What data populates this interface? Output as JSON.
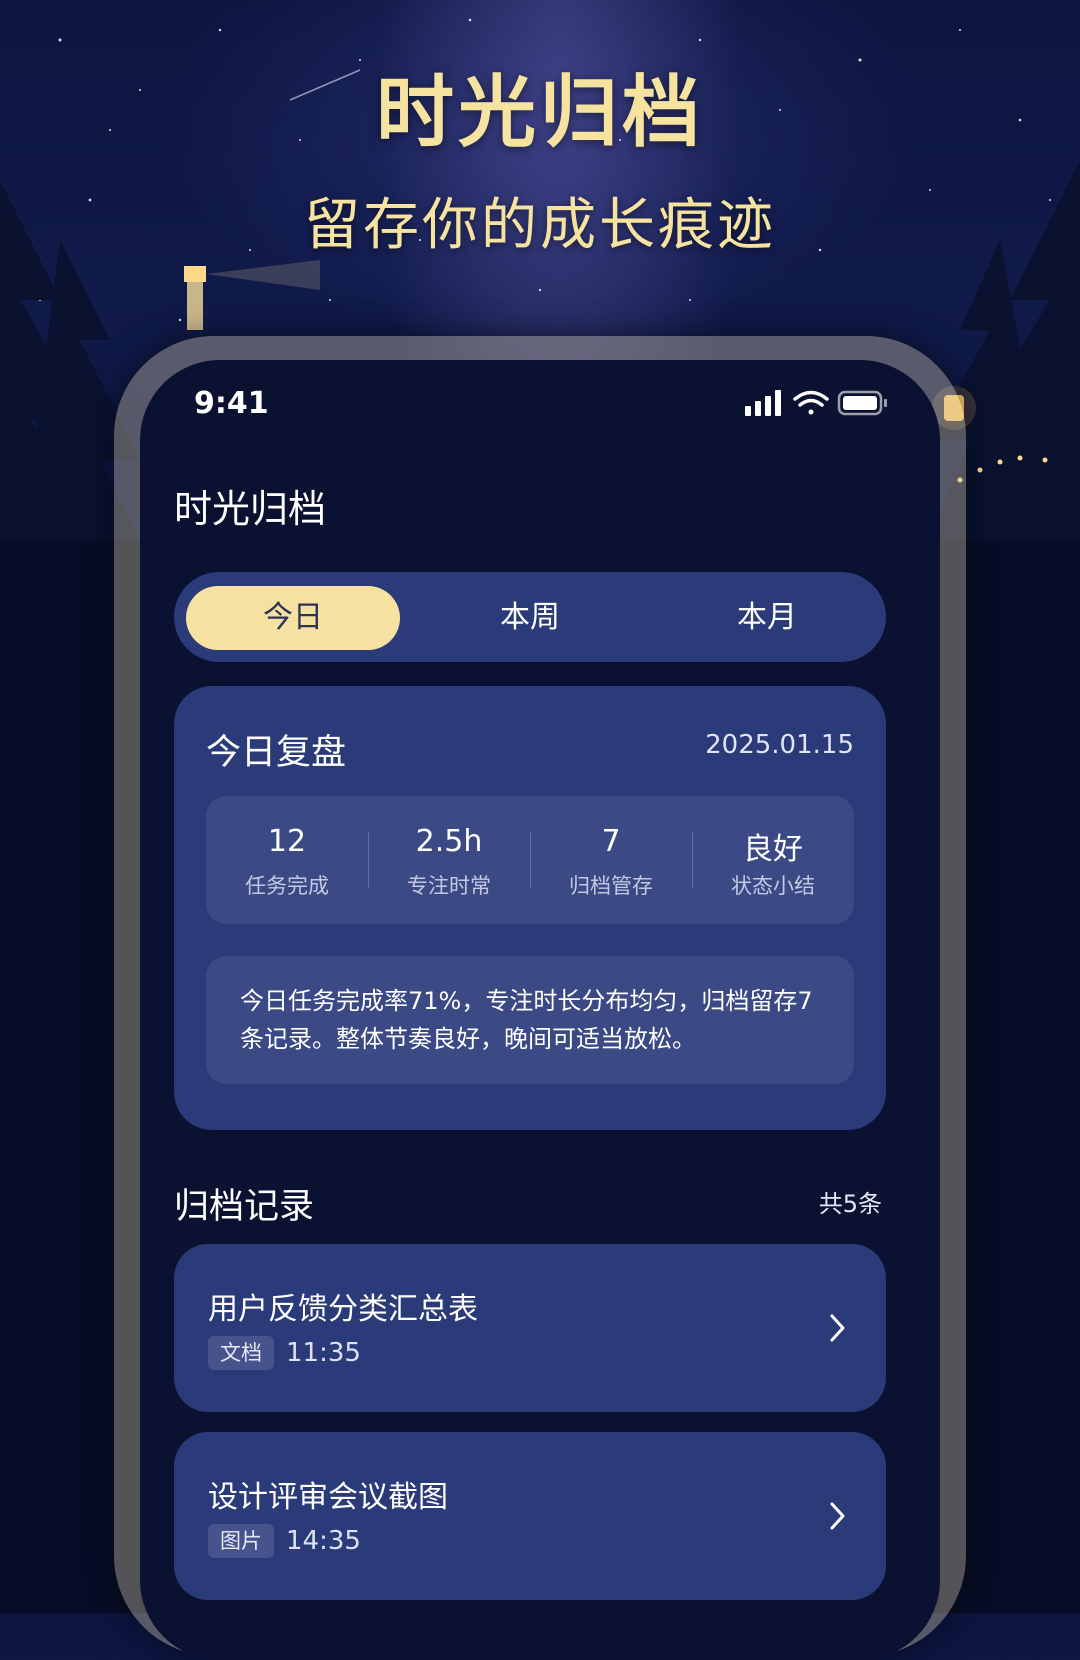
{
  "hero": {
    "title": "时光归档",
    "subtitle": "留存你的成长痕迹"
  },
  "status_bar": {
    "time": "9:41",
    "icons": [
      "cellular-signal-icon",
      "wifi-icon",
      "battery-icon"
    ]
  },
  "app": {
    "title": "时光归档"
  },
  "tabs": [
    {
      "label": "今日",
      "active": true
    },
    {
      "label": "本周",
      "active": false
    },
    {
      "label": "本月",
      "active": false
    }
  ],
  "review": {
    "title": "今日复盘",
    "date": "2025.01.15",
    "stats": [
      {
        "value": "12",
        "label": "任务完成"
      },
      {
        "value": "2.5h",
        "label": "专注时常"
      },
      {
        "value": "7",
        "label": "归档管存"
      },
      {
        "value": "良好",
        "label": "状态小结"
      }
    ],
    "summary": "今日任务完成率71%，专注时长分布均匀，归档留存7条记录。整体节奏良好，晚间可适当放松。"
  },
  "records_section": {
    "title": "归档记录",
    "count": "共5条"
  },
  "records": [
    {
      "title": "用户反馈分类汇总表",
      "tag": "文档",
      "time": "11:35"
    },
    {
      "title": "设计评审会议截图",
      "tag": "图片",
      "time": "14:35"
    }
  ],
  "colors": {
    "accent_gold": "#f7e1a0",
    "card_blue": "#2b3a78",
    "screen_bg": "#0a1131"
  }
}
